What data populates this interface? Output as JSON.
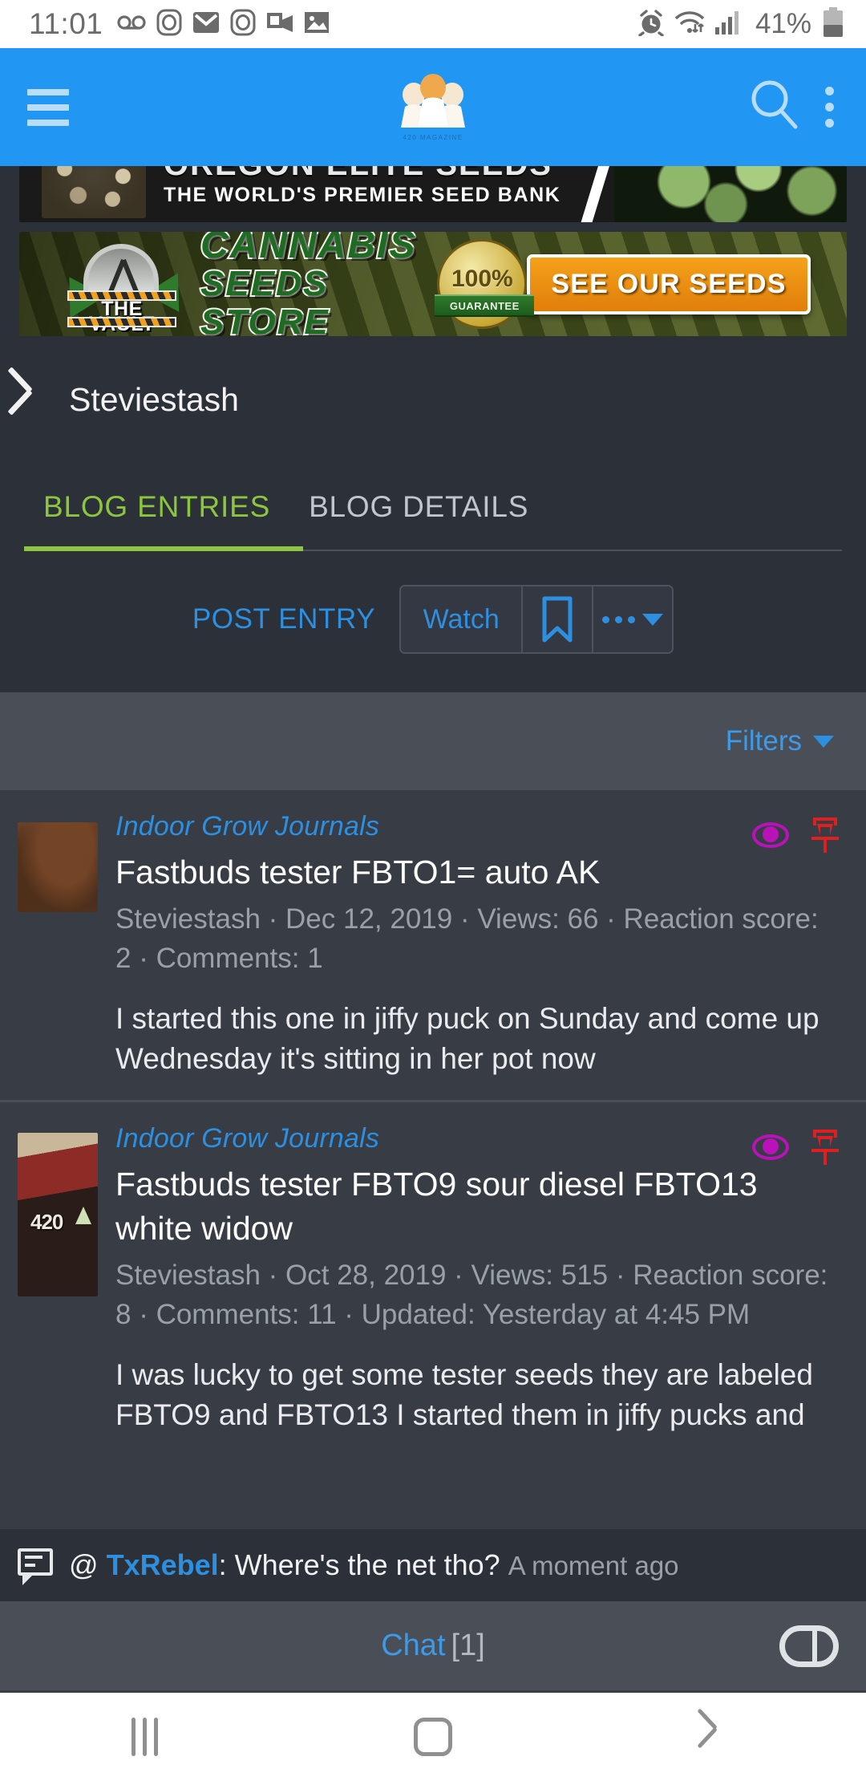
{
  "status_bar": {
    "time": "11:01",
    "battery_percent": "41%",
    "left_icons": [
      "voicemail-icon",
      "instagram-icon",
      "gmail-icon",
      "instagram-icon",
      "outlook-icon",
      "gallery-icon"
    ],
    "right_icons": [
      "alarm-icon",
      "wifi-icon",
      "signal-icon",
      "battery-icon"
    ]
  },
  "app_bar": {
    "menu_icon": "hamburger-menu-icon",
    "logo_caption": "420 MAGAZINE",
    "search_icon": "search-icon",
    "overflow_icon": "kebab-menu-icon"
  },
  "ads": [
    {
      "name": "oregon-elite-seeds",
      "line1": "OREGON ELITE SEEDS",
      "line2": "THE WORLD'S PREMIER SEED BANK"
    },
    {
      "name": "the-vault-cannabis-seeds-store",
      "brand": "THE VAULT",
      "title_line1": "CANNABIS",
      "title_line2": "SEEDS STORE",
      "badge_number": "100%",
      "badge_ribbon": "GUARANTEE",
      "cta": "SEE OUR SEEDS"
    }
  ],
  "header": {
    "back_icon": "chevron-left-icon",
    "title": "Steviestash"
  },
  "tabs": [
    {
      "label": "BLOG ENTRIES",
      "active": true
    },
    {
      "label": "BLOG DETAILS",
      "active": false
    }
  ],
  "actions": {
    "post_entry": "POST ENTRY",
    "watch": "Watch",
    "bookmark_icon": "bookmark-icon",
    "more_icon": "more-options-icon"
  },
  "filters": {
    "label": "Filters",
    "caret_icon": "caret-down-icon"
  },
  "entries": [
    {
      "forum": "Indoor Grow Journals",
      "title": "Fastbuds tester FBTO1= auto AK",
      "meta": "Steviestash · Dec 12, 2019 · Views: 66 · Reaction score: 2 · Comments: 1",
      "excerpt": "I started this one in jiffy puck on Sunday and come up Wednesday it's sitting in her pot now",
      "watched_icon": "eye-icon",
      "pinned_icon": "pin-icon"
    },
    {
      "forum": "Indoor Grow Journals",
      "title": "Fastbuds tester FBTO9 sour diesel FBTO13 white widow",
      "meta": "Steviestash · Oct 28, 2019 · Views: 515 · Reaction score: 8 · Comments: 11 · Updated: Yesterday at 4:45 PM",
      "excerpt": "I was lucky to get some tester seeds they are labeled FBTO9 and FBTO13 I started them in jiffy pucks and",
      "watched_icon": "eye-icon",
      "pinned_icon": "pin-icon"
    }
  ],
  "chat_notification": {
    "icon": "chat-bubble-icon",
    "at": "@",
    "username": "TxRebel",
    "separator": ":",
    "message": "Where's the net tho?",
    "time": "A moment ago"
  },
  "chat_bar": {
    "label": "Chat",
    "count": "[1]",
    "toggle_icon": "chat-toggle-icon"
  },
  "nav_bar": {
    "recents_icon": "recents-icon",
    "home_icon": "home-icon",
    "back_icon": "back-icon"
  },
  "colors": {
    "accent_blue": "#2196f3",
    "link_blue": "#2d8fe0",
    "active_tab_green": "#8cc63f",
    "header_bg": "#2c3038",
    "filter_bg": "#4a4e57",
    "entry_bg": "#383c44",
    "watched_magenta": "#b812b8",
    "pin_red": "#e02020",
    "cta_orange": "#f5a11a"
  }
}
